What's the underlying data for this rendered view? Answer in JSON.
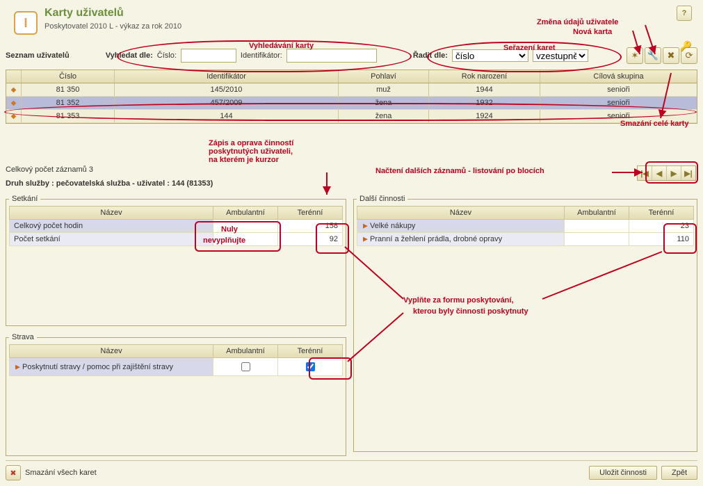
{
  "header": {
    "title": "Karty uživatelů",
    "subtitle": "Poskytovatel 2010 L - výkaz za rok 2010",
    "help_icon": "?",
    "key_icon": "🔑"
  },
  "search": {
    "section_label": "Seznam uživatelů",
    "find_label": "Vyhledat dle:",
    "cislo_label": "Číslo:",
    "ident_label": "Identifikátor:",
    "cislo_value": "",
    "ident_value": ""
  },
  "sort": {
    "label": "Řadit dle:",
    "field_options": [
      "číslo"
    ],
    "field_value": "číslo",
    "dir_options": [
      "vzestupně"
    ],
    "dir_value": "vzestupně"
  },
  "toolbar": {
    "new_icon": "✶",
    "edit_icon": "🔧",
    "delete_icon": "✖",
    "refresh_icon": "⟳"
  },
  "grid": {
    "columns": [
      "",
      "Číslo",
      "Identifikátor",
      "Pohlaví",
      "Rok narození",
      "Cílová skupina"
    ],
    "rows": [
      {
        "cislo": "81 350",
        "ident": "145/2010",
        "pohlavi": "muž",
        "rok": "1944",
        "skupina": "senioři",
        "sel": false
      },
      {
        "cislo": "81 352",
        "ident": "457/2009",
        "pohlavi": "žena",
        "rok": "1932",
        "skupina": "senioři",
        "sel": true
      },
      {
        "cislo": "81 353",
        "ident": "144",
        "pohlavi": "žena",
        "rok": "1924",
        "skupina": "senioři",
        "sel": false
      }
    ]
  },
  "total_row": "Celkový počet záznamů 3",
  "service_line": "Druh služby : pečovatelská služba - uživatel : 144 (81353)",
  "pager": {
    "first": "|◀",
    "prev": "◀",
    "next": "▶",
    "last": "▶|"
  },
  "setkani": {
    "legend": "Setkání",
    "col_name": "Název",
    "col_amb": "Ambulantní",
    "col_ter": "Terénní",
    "rows": [
      {
        "name": "Celkový počet hodin",
        "amb": "",
        "ter": "158"
      },
      {
        "name": "Počet setkání",
        "amb": "",
        "ter": "92"
      }
    ]
  },
  "dalsi": {
    "legend": "Další činnosti",
    "col_name": "Název",
    "col_amb": "Ambulantní",
    "col_ter": "Terénní",
    "rows": [
      {
        "name": "Velké nákupy",
        "amb": "",
        "ter": "23"
      },
      {
        "name": "Pranní a žehlení prádla, drobné opravy",
        "amb": "",
        "ter": "110"
      }
    ]
  },
  "strava": {
    "legend": "Strava",
    "col_name": "Název",
    "col_amb": "Ambulantní",
    "col_ter": "Terénní",
    "rows": [
      {
        "name": "Poskytnutí stravy / pomoc při zajištění stravy",
        "amb": false,
        "ter": true
      }
    ]
  },
  "footer": {
    "delete_all": "Smazání všech karet",
    "save": "Uložit činnosti",
    "back": "Zpět",
    "del_icon": "✖"
  },
  "annotations": {
    "a1": "Vyhledávání karty",
    "a2": "Seřazení karet",
    "a3": "Změna údajů uživatele",
    "a4": "Nová karta",
    "a5": "Smazání celé karty",
    "a6": "Zápis a oprava činností\nposkytnutých uživateli,\nna kterém je kurzor",
    "a7": "Načtení dalších záznamů - listování po blocích",
    "a8_l1": "Nuly",
    "a8_l2": "nevyplňujte",
    "a9_l1": "Vyplňte za formu poskytování,",
    "a9_l2": "kterou byly činnosti poskytnuty"
  }
}
